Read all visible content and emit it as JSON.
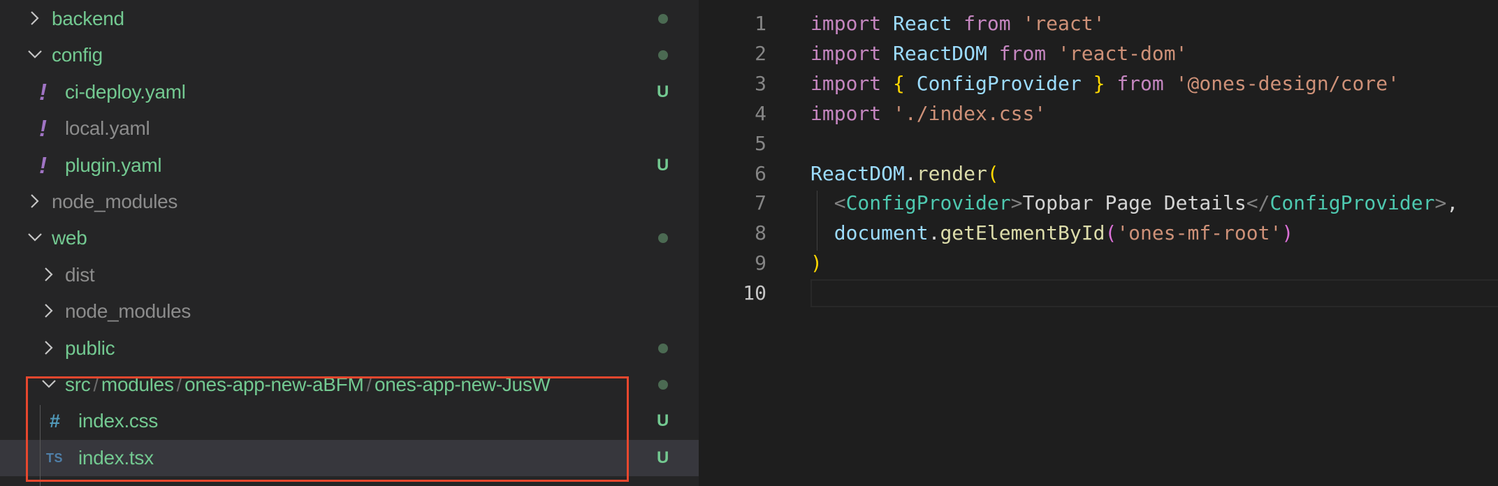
{
  "explorer": {
    "items": [
      {
        "name": "backend",
        "expanded": false,
        "git_dot": true
      },
      {
        "name": "config",
        "expanded": true,
        "git_dot": true
      },
      {
        "name": "ci-deploy.yaml",
        "icon": "yaml-exclamation-icon",
        "git_status": "U"
      },
      {
        "name": "local.yaml",
        "icon": "yaml-exclamation-icon"
      },
      {
        "name": "plugin.yaml",
        "icon": "yaml-exclamation-icon",
        "git_status": "U"
      },
      {
        "name": "node_modules",
        "expanded": false
      },
      {
        "name": "web",
        "expanded": true,
        "git_dot": true
      },
      {
        "name": "dist",
        "expanded": false
      },
      {
        "name": "node_modules",
        "expanded": false
      },
      {
        "name": "public",
        "expanded": false,
        "git_dot": true
      },
      {
        "name_parts": [
          "src",
          "modules",
          "ones-app-new-aBFM",
          "ones-app-new-JusW"
        ],
        "separator": "/",
        "expanded": true,
        "git_dot": true
      },
      {
        "name": "index.css",
        "icon": "hash-icon",
        "icon_glyph": "#",
        "git_status": "U"
      },
      {
        "name": "index.tsx",
        "icon": "ts-icon",
        "icon_glyph": "TS",
        "git_status": "U",
        "selected": true
      }
    ],
    "colors": {
      "untracked": "#73c991",
      "ignored": "#8c8c8c",
      "git_dot": "#4b6a52",
      "highlight_box": "#e8472e"
    }
  },
  "editor": {
    "active_line": 10,
    "lines": [
      {
        "num": "1",
        "tokens": [
          [
            "kw",
            "import"
          ],
          [
            "txt",
            " "
          ],
          [
            "var",
            "React"
          ],
          [
            "txt",
            " "
          ],
          [
            "kw",
            "from"
          ],
          [
            "txt",
            " "
          ],
          [
            "str",
            "'react'"
          ]
        ]
      },
      {
        "num": "2",
        "tokens": [
          [
            "kw",
            "import"
          ],
          [
            "txt",
            " "
          ],
          [
            "var",
            "ReactDOM"
          ],
          [
            "txt",
            " "
          ],
          [
            "kw",
            "from"
          ],
          [
            "txt",
            " "
          ],
          [
            "str",
            "'react-dom'"
          ]
        ]
      },
      {
        "num": "3",
        "tokens": [
          [
            "kw",
            "import"
          ],
          [
            "txt",
            " "
          ],
          [
            "br",
            "{"
          ],
          [
            "txt",
            " "
          ],
          [
            "var",
            "ConfigProvider"
          ],
          [
            "txt",
            " "
          ],
          [
            "br",
            "}"
          ],
          [
            "txt",
            " "
          ],
          [
            "kw",
            "from"
          ],
          [
            "txt",
            " "
          ],
          [
            "str",
            "'@ones-design/core'"
          ]
        ]
      },
      {
        "num": "4",
        "tokens": [
          [
            "kw",
            "import"
          ],
          [
            "txt",
            " "
          ],
          [
            "str",
            "'./index.css'"
          ]
        ]
      },
      {
        "num": "5",
        "tokens": []
      },
      {
        "num": "6",
        "tokens": [
          [
            "var",
            "ReactDOM"
          ],
          [
            "txt",
            "."
          ],
          [
            "fn",
            "render"
          ],
          [
            "br",
            "("
          ]
        ]
      },
      {
        "num": "7",
        "tokens": [
          [
            "txt",
            "  "
          ],
          [
            "punc",
            "<"
          ],
          [
            "tag",
            "ConfigProvider"
          ],
          [
            "punc",
            ">"
          ],
          [
            "txt",
            "Topbar Page Details"
          ],
          [
            "punc",
            "</"
          ],
          [
            "tag",
            "ConfigProvider"
          ],
          [
            "punc",
            ">"
          ],
          [
            "txt",
            ","
          ]
        ]
      },
      {
        "num": "8",
        "tokens": [
          [
            "txt",
            "  "
          ],
          [
            "var",
            "document"
          ],
          [
            "txt",
            "."
          ],
          [
            "fn",
            "getElementById"
          ],
          [
            "br2",
            "("
          ],
          [
            "str",
            "'ones-mf-root'"
          ],
          [
            "br2",
            ")"
          ]
        ]
      },
      {
        "num": "9",
        "tokens": [
          [
            "br",
            ")"
          ]
        ]
      },
      {
        "num": "10",
        "tokens": []
      }
    ]
  }
}
